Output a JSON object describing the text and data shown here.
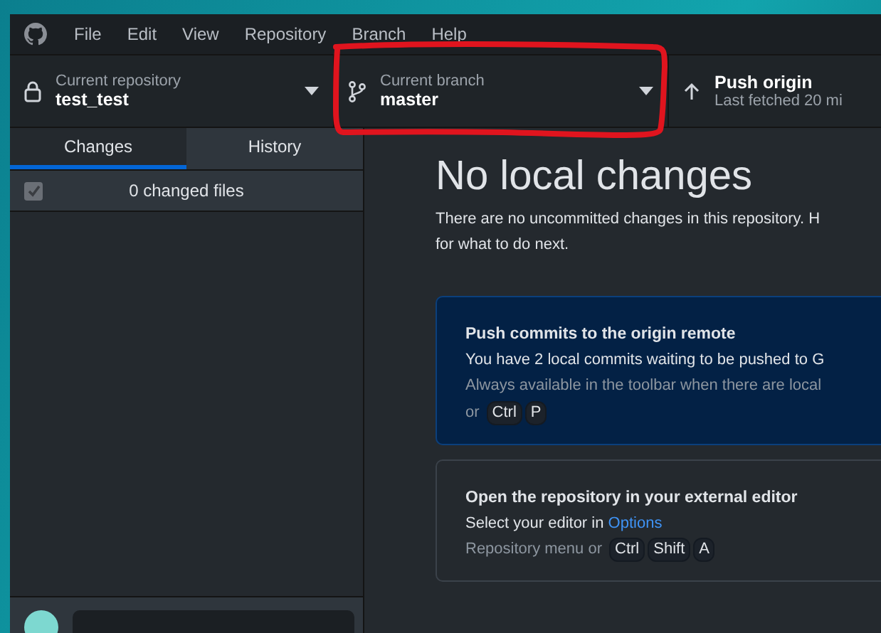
{
  "menu": [
    "File",
    "Edit",
    "View",
    "Repository",
    "Branch",
    "Help"
  ],
  "toolbar": {
    "repository": {
      "caption": "Current repository",
      "value": "test_test"
    },
    "branch": {
      "caption": "Current branch",
      "value": "master",
      "circled": true
    },
    "push": {
      "caption": "Push origin",
      "detail": "Last fetched 20 mi"
    }
  },
  "tabs": [
    {
      "label": "Changes",
      "selected": true
    },
    {
      "label": "History",
      "selected": false
    }
  ],
  "changes": {
    "checked": true,
    "summary": "0 changed files"
  },
  "main": {
    "heading": "No local changes",
    "text": [
      "There are no uncommitted changes in this repository. H",
      "for what to do next."
    ],
    "cards": [
      {
        "kind": "primary",
        "title": "Push commits to the origin remote",
        "text": "You have 2 local commits waiting to be pushed to G",
        "hint": [
          "Always available in the toolbar when there are local",
          "or"
        ],
        "keys": [
          "Ctrl",
          "P"
        ]
      },
      {
        "kind": "plain",
        "title": "Open the repository in your external editor",
        "text": "Select your editor in",
        "link": "Options",
        "hint": [
          "Repository menu or"
        ],
        "keys": [
          "Ctrl",
          "Shift",
          "A"
        ]
      }
    ]
  }
}
